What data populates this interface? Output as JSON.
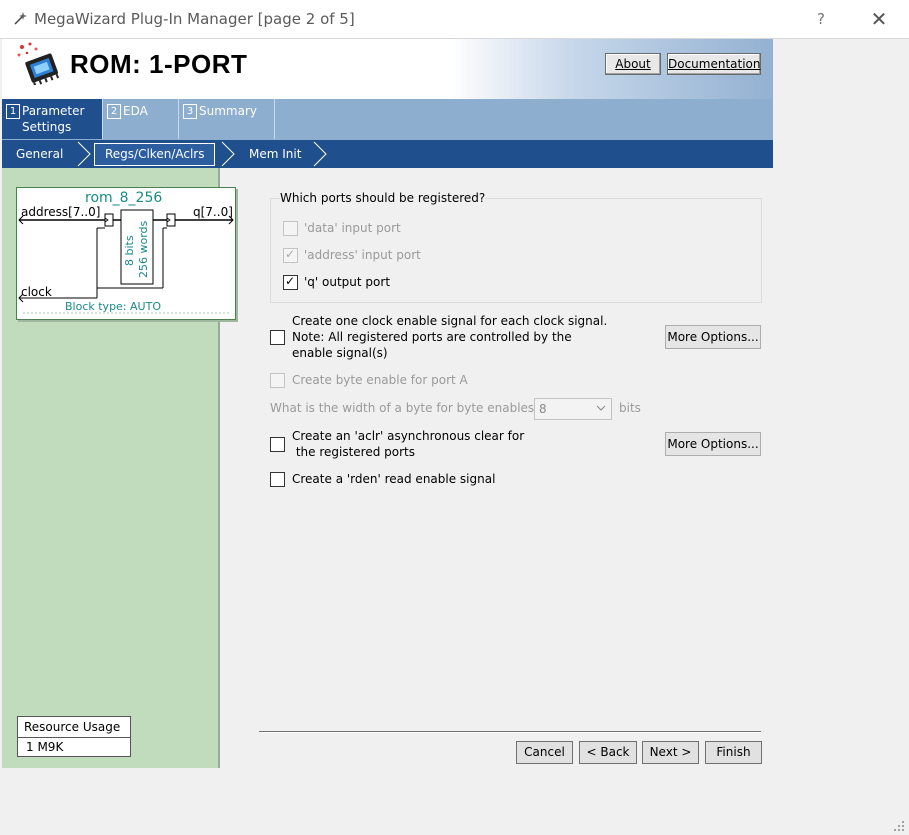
{
  "window": {
    "title": "MegaWizard Plug-In Manager [page 2 of 5]",
    "help": "?",
    "close": "✕"
  },
  "header": {
    "title": "ROM: 1-PORT",
    "about": "About",
    "documentation": "Documentation"
  },
  "tabs": [
    {
      "num": "1",
      "label_line1": "Parameter",
      "label_line2": "Settings"
    },
    {
      "num": "2",
      "label": "EDA"
    },
    {
      "num": "3",
      "label": "Summary"
    }
  ],
  "subtabs": {
    "general": "General",
    "regs": "Regs/Clken/Aclrs",
    "meminit": "Mem Init"
  },
  "diagram": {
    "name": "rom_8_256",
    "address_port": "address[7..0]",
    "q_port": "q[7..0]",
    "clock_port": "clock",
    "bits": "8 bits",
    "words": "256 words",
    "block_type": "Block type: AUTO"
  },
  "resource": {
    "title": "Resource Usage",
    "value": "1 M9K"
  },
  "registered_ports": {
    "title": "Which ports should be registered?",
    "data_port": "'data' input port",
    "address_port": "'address' input port",
    "q_port": "'q' output port"
  },
  "options": {
    "clock_enable_line1": "Create one clock enable signal for each clock signal.",
    "clock_enable_line2": "Note: All registered ports are controlled by the",
    "clock_enable_line3": "enable signal(s)",
    "more_options": "More Options...",
    "byte_enable": "Create byte enable for port A",
    "byte_width_question": "What is the width of a byte for byte enables?",
    "byte_width_value": "8",
    "byte_width_unit": "bits",
    "aclr_line1": "Create an 'aclr' asynchronous clear for",
    "aclr_line2": " the registered ports",
    "rden": "Create a 'rden' read enable signal"
  },
  "nav": {
    "cancel": "Cancel",
    "back": "< Back",
    "next": "Next >",
    "finish": "Finish"
  },
  "colors": {
    "nav_dark": "#1f4f8d",
    "nav_light": "#8eaed0",
    "left_panel": "#c0dcbc",
    "diagram_text": "#1a8a8a"
  }
}
